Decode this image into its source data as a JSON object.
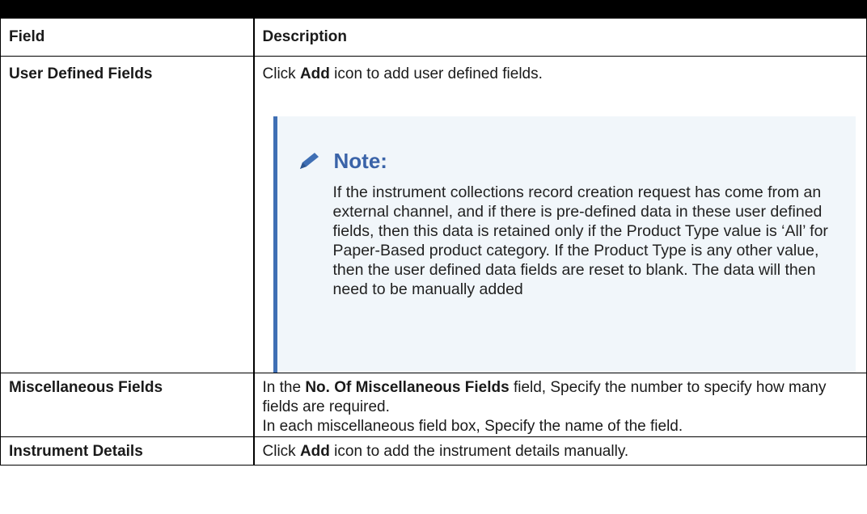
{
  "table": {
    "headers": {
      "field": "Field",
      "description": "Description"
    },
    "rows": [
      {
        "field": "User Defined Fields",
        "desc_pre": "Click ",
        "desc_bold": "Add",
        "desc_post": " icon to add user defined fields.",
        "note": {
          "title": "Note:",
          "icon": "pencil-icon",
          "body": "If the instrument collections record creation request has come from an external channel, and if there is pre-defined data in these user defined fields, then this data is retained only if the Product Type value is ‘All’ for Paper-Based product category. If the Product Type is any other value, then the user defined data fields are reset to blank. The data will then need to be manually added"
        }
      },
      {
        "field": "Miscellaneous Fields",
        "desc_pre": "In the ",
        "desc_bold": "No. Of Miscellaneous Fields",
        "desc_post": " field, Specify the number to specify how many fields are required.",
        "desc_line2": "In each miscellaneous field box, Specify the name of the field."
      },
      {
        "field": "Instrument Details",
        "desc_pre": "Click ",
        "desc_bold": "Add",
        "desc_post": " icon to add the instrument details manually."
      }
    ]
  },
  "colors": {
    "note_accent": "#3f6fb4",
    "note_title": "#3a63a8",
    "note_background": "#f1f6fa"
  }
}
